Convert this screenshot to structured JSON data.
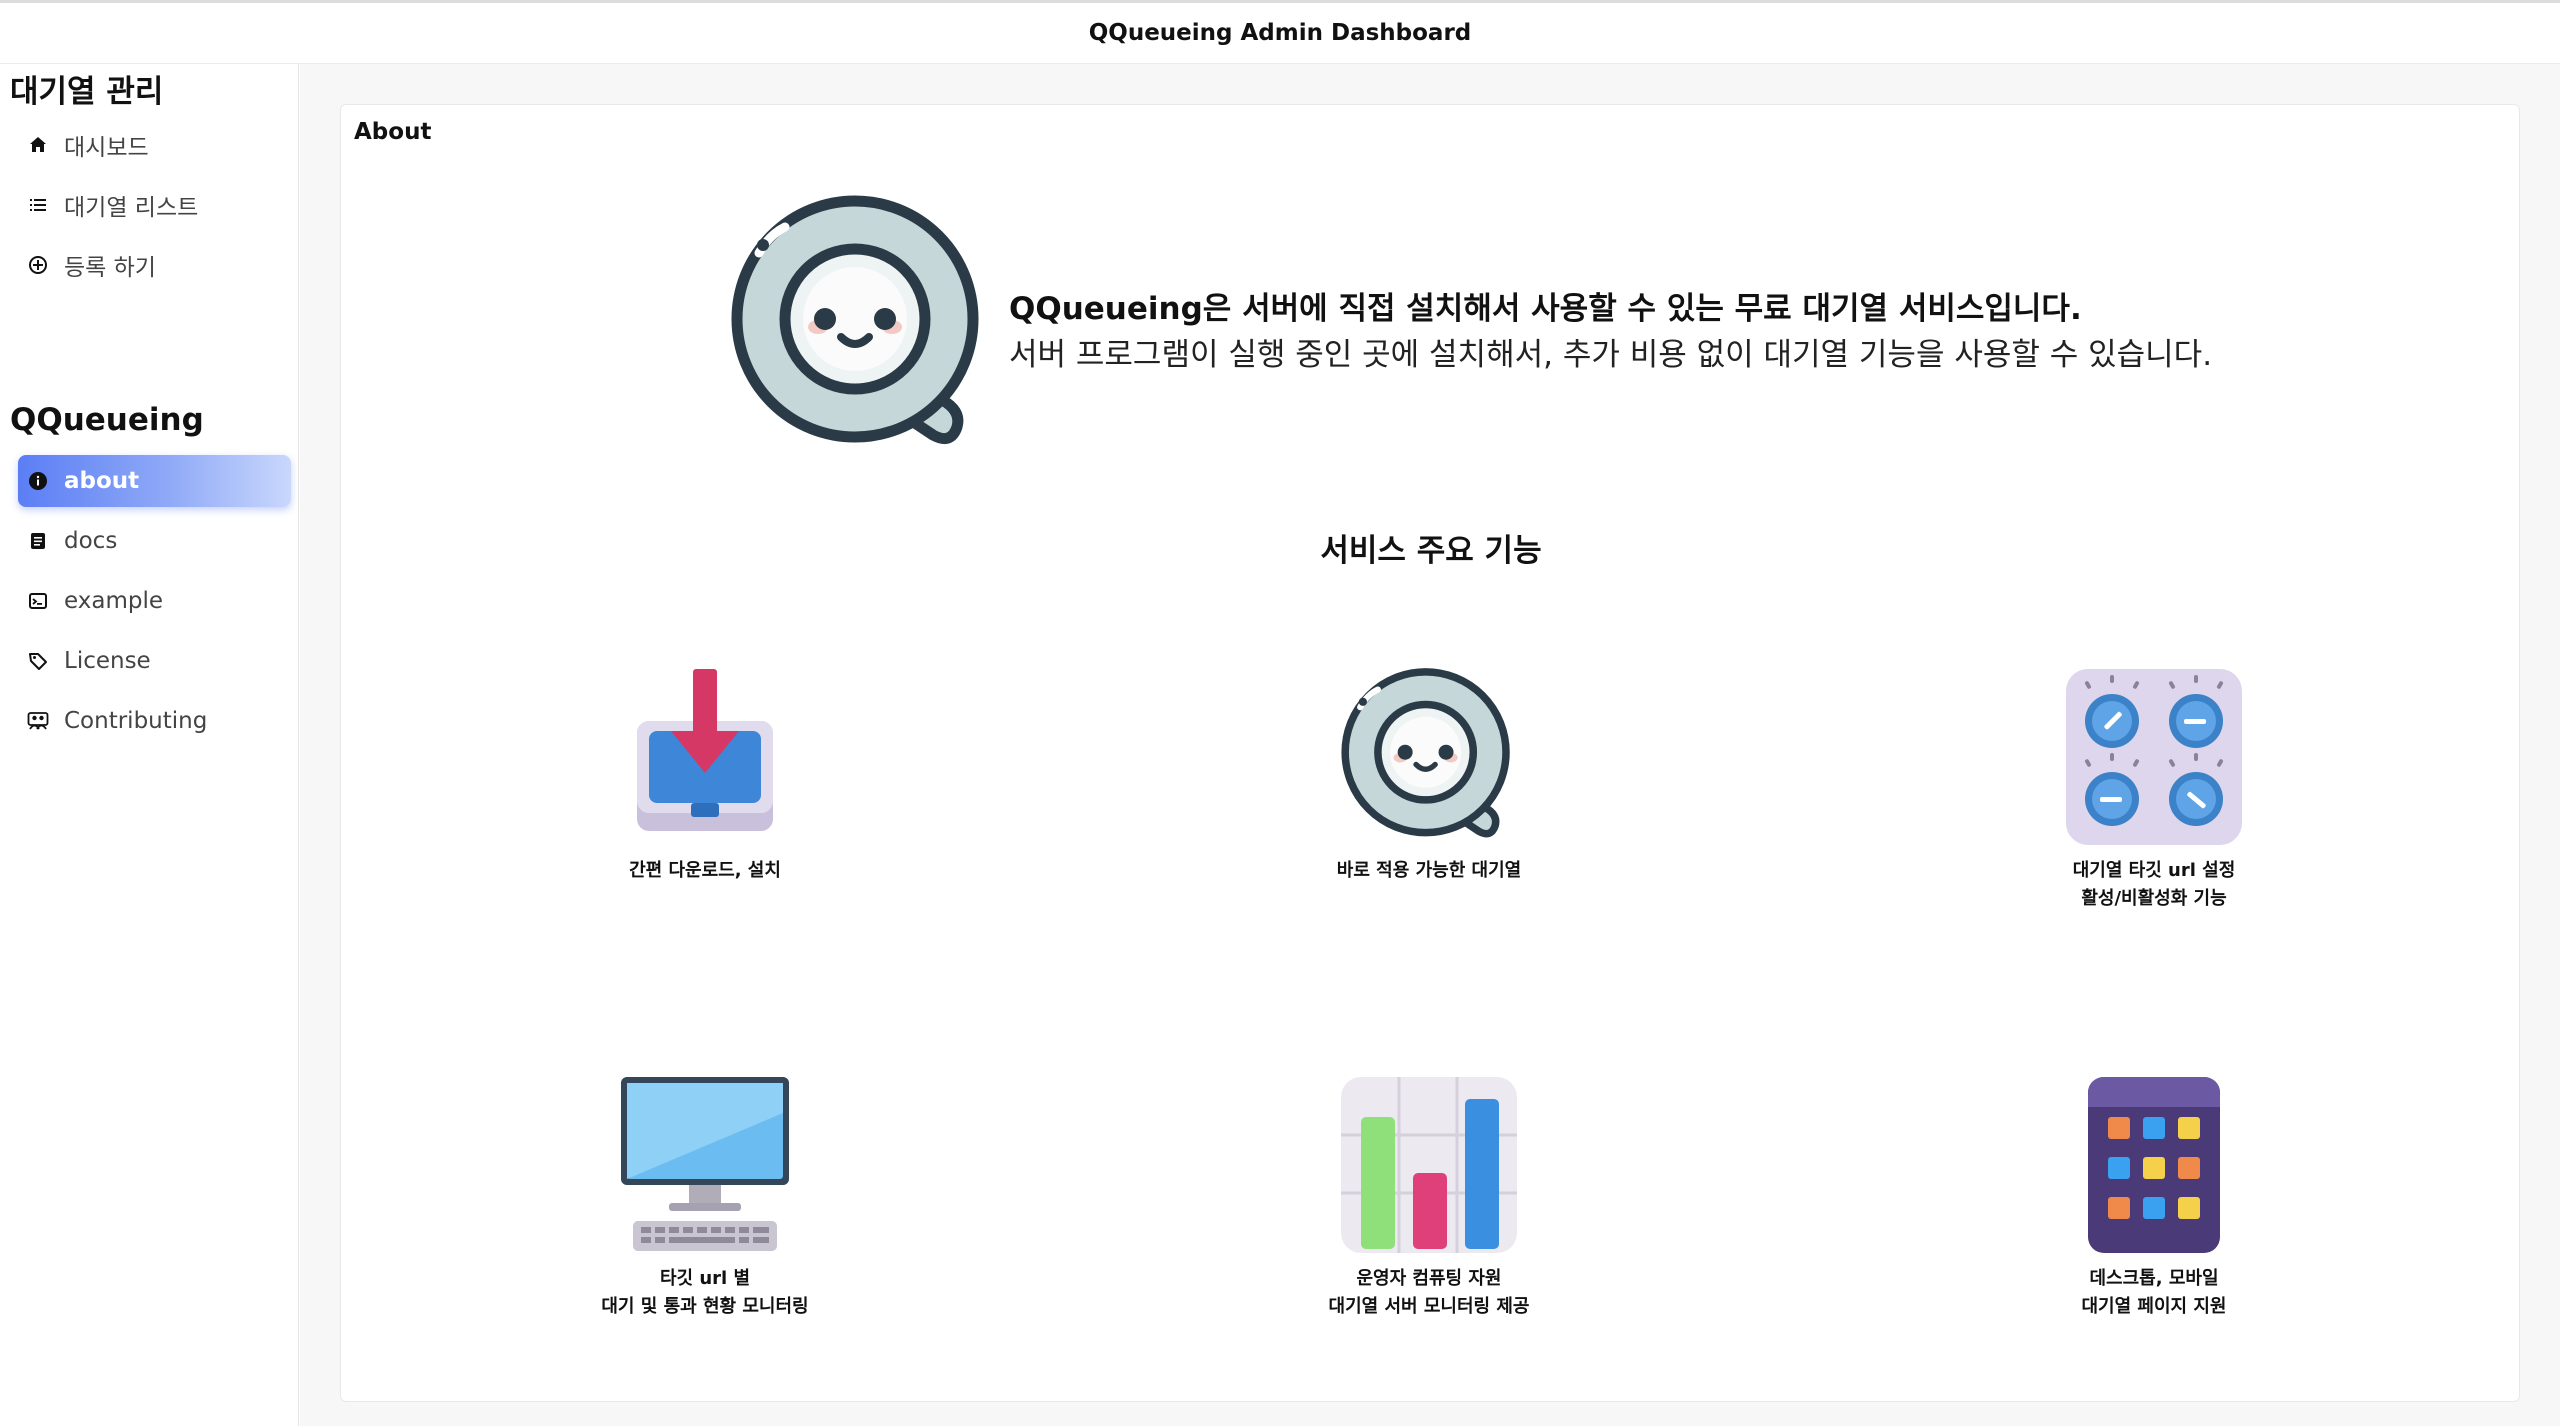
{
  "app": {
    "title": "QQueueing Admin Dashboard"
  },
  "sidebar": {
    "section1": {
      "title": "대기열 관리",
      "items": [
        {
          "label": "대시보드",
          "icon": "home-icon"
        },
        {
          "label": "대기열 리스트",
          "icon": "list-icon"
        },
        {
          "label": "등록 하기",
          "icon": "plus-circle-icon"
        }
      ]
    },
    "section2": {
      "title": "QQueueing",
      "items": [
        {
          "label": "about",
          "icon": "info-icon",
          "active": true
        },
        {
          "label": "docs",
          "icon": "document-icon"
        },
        {
          "label": "example",
          "icon": "terminal-icon"
        },
        {
          "label": "License",
          "icon": "tag-icon"
        },
        {
          "label": "Contributing",
          "icon": "people-icon"
        }
      ]
    }
  },
  "main": {
    "card_title": "About",
    "hero": {
      "line1": "QQueueing은 서버에 직접 설치해서 사용할 수 있는 무료 대기열 서비스입니다.",
      "line2": "서버 프로그램이 실행 중인 곳에 설치해서, 추가 비용 없이 대기열 기능을 사용할 수 있습니다."
    },
    "features_title": "서비스 주요 기능",
    "features": [
      {
        "line1": "간편 다운로드, 설치",
        "line2": "",
        "icon": "download-tray-icon"
      },
      {
        "line1": "바로 적용 가능한 대기열",
        "line2": "",
        "icon": "qqueueing-logo-icon"
      },
      {
        "line1": "대기열 타깃 url 설정",
        "line2": "활성/비활성화 기능",
        "icon": "control-knobs-icon"
      },
      {
        "line1": "타깃 url 별",
        "line2": "대기 및 통과 현황 모니터링",
        "icon": "desktop-computer-icon"
      },
      {
        "line1": "운영자 컴퓨팅 자원",
        "line2": "대기열 서버 모니터링 제공",
        "icon": "bar-chart-icon"
      },
      {
        "line1": "데스크톱, 모바일",
        "line2": "대기열 페이지 지원",
        "icon": "mobile-apps-icon"
      }
    ]
  },
  "colors": {
    "accent": "#5b7ef5",
    "logo_fill": "#c5d7d9",
    "logo_stroke": "#2a3a46"
  }
}
